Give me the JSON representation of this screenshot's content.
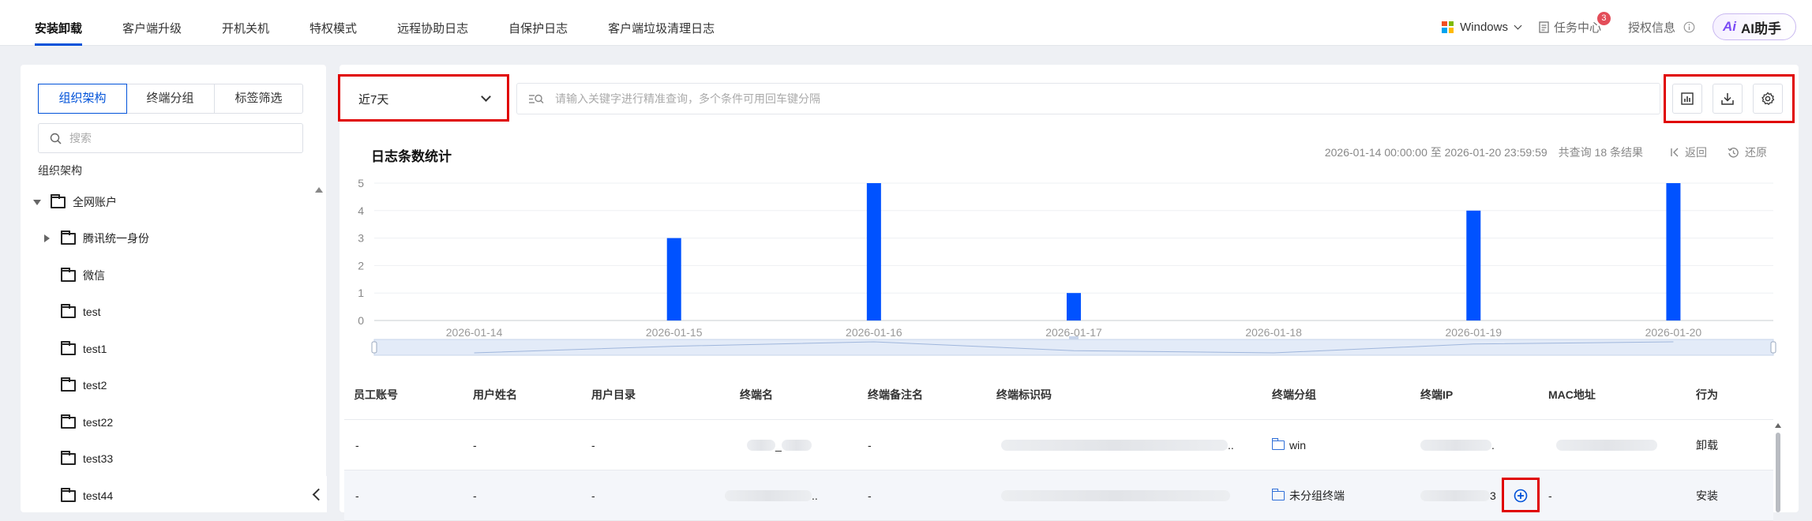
{
  "nav_tabs": [
    {
      "label": "安装卸载",
      "active": true
    },
    {
      "label": "客户端升级",
      "active": false
    },
    {
      "label": "开机关机",
      "active": false
    },
    {
      "label": "特权模式",
      "active": false
    },
    {
      "label": "远程协助日志",
      "active": false
    },
    {
      "label": "自保护日志",
      "active": false
    },
    {
      "label": "客户端垃圾清理日志",
      "active": false
    }
  ],
  "top_right": {
    "os_label": "Windows",
    "task_center": "任务中心",
    "task_badge": "3",
    "license_info": "授权信息",
    "ai_mark": "Ai",
    "ai_label": "AI助手"
  },
  "left_panel": {
    "segments": [
      {
        "label": "组织架构",
        "active": true
      },
      {
        "label": "终端分组",
        "active": false
      },
      {
        "label": "标签筛选",
        "active": false
      }
    ],
    "search_placeholder": "搜索",
    "section_label": "组织架构",
    "tree": [
      {
        "label": "全网账户",
        "level": 0,
        "expanded": true
      },
      {
        "label": "腾讯统一身份",
        "level": 1,
        "expandable": true
      },
      {
        "label": "微信",
        "level": 1
      },
      {
        "label": "test",
        "level": 1
      },
      {
        "label": "test1",
        "level": 1
      },
      {
        "label": "test2",
        "level": 1
      },
      {
        "label": "test22",
        "level": 1
      },
      {
        "label": "test33",
        "level": 1
      },
      {
        "label": "test44",
        "level": 1
      }
    ]
  },
  "filter": {
    "time_range": "近7天",
    "query_placeholder": "请输入关键字进行精准查询，多个条件可用回车键分隔"
  },
  "chart_header": {
    "title": "日志条数统计",
    "range_text": "2026-01-14 00:00:00 至 2026-01-20 23:59:59",
    "count_text": "共查询 18 条结果",
    "back_label": "返回",
    "restore_label": "还原"
  },
  "chart_data": {
    "type": "bar",
    "categories": [
      "2026-01-14",
      "2026-01-15",
      "2026-01-16",
      "2026-01-17",
      "2026-01-18",
      "2026-01-19",
      "2026-01-20"
    ],
    "values": [
      0,
      3,
      5,
      1,
      0,
      4,
      5
    ],
    "ylim": [
      0,
      5
    ],
    "yticks": [
      0,
      1,
      2,
      3,
      4,
      5
    ],
    "grid": true,
    "bar_color": "#0052ff"
  },
  "table": {
    "columns": [
      "员工账号",
      "用户姓名",
      "用户目录",
      "终端名",
      "终端备注名",
      "终端标识码",
      "终端分组",
      "终端IP",
      "MAC地址",
      "行为"
    ],
    "rows": [
      {
        "account": "-",
        "name": "-",
        "dir": "-",
        "terminal": "_",
        "remark": "-",
        "id_suffix": "..",
        "group": "win",
        "ip_suffix": ".",
        "mac": "",
        "action": "卸载"
      },
      {
        "account": "-",
        "name": "-",
        "dir": "-",
        "terminal": "..",
        "remark": "-",
        "id_suffix": "",
        "group": "未分组终端",
        "ip_suffix": "3",
        "mac": "-",
        "action": "安装"
      }
    ]
  }
}
